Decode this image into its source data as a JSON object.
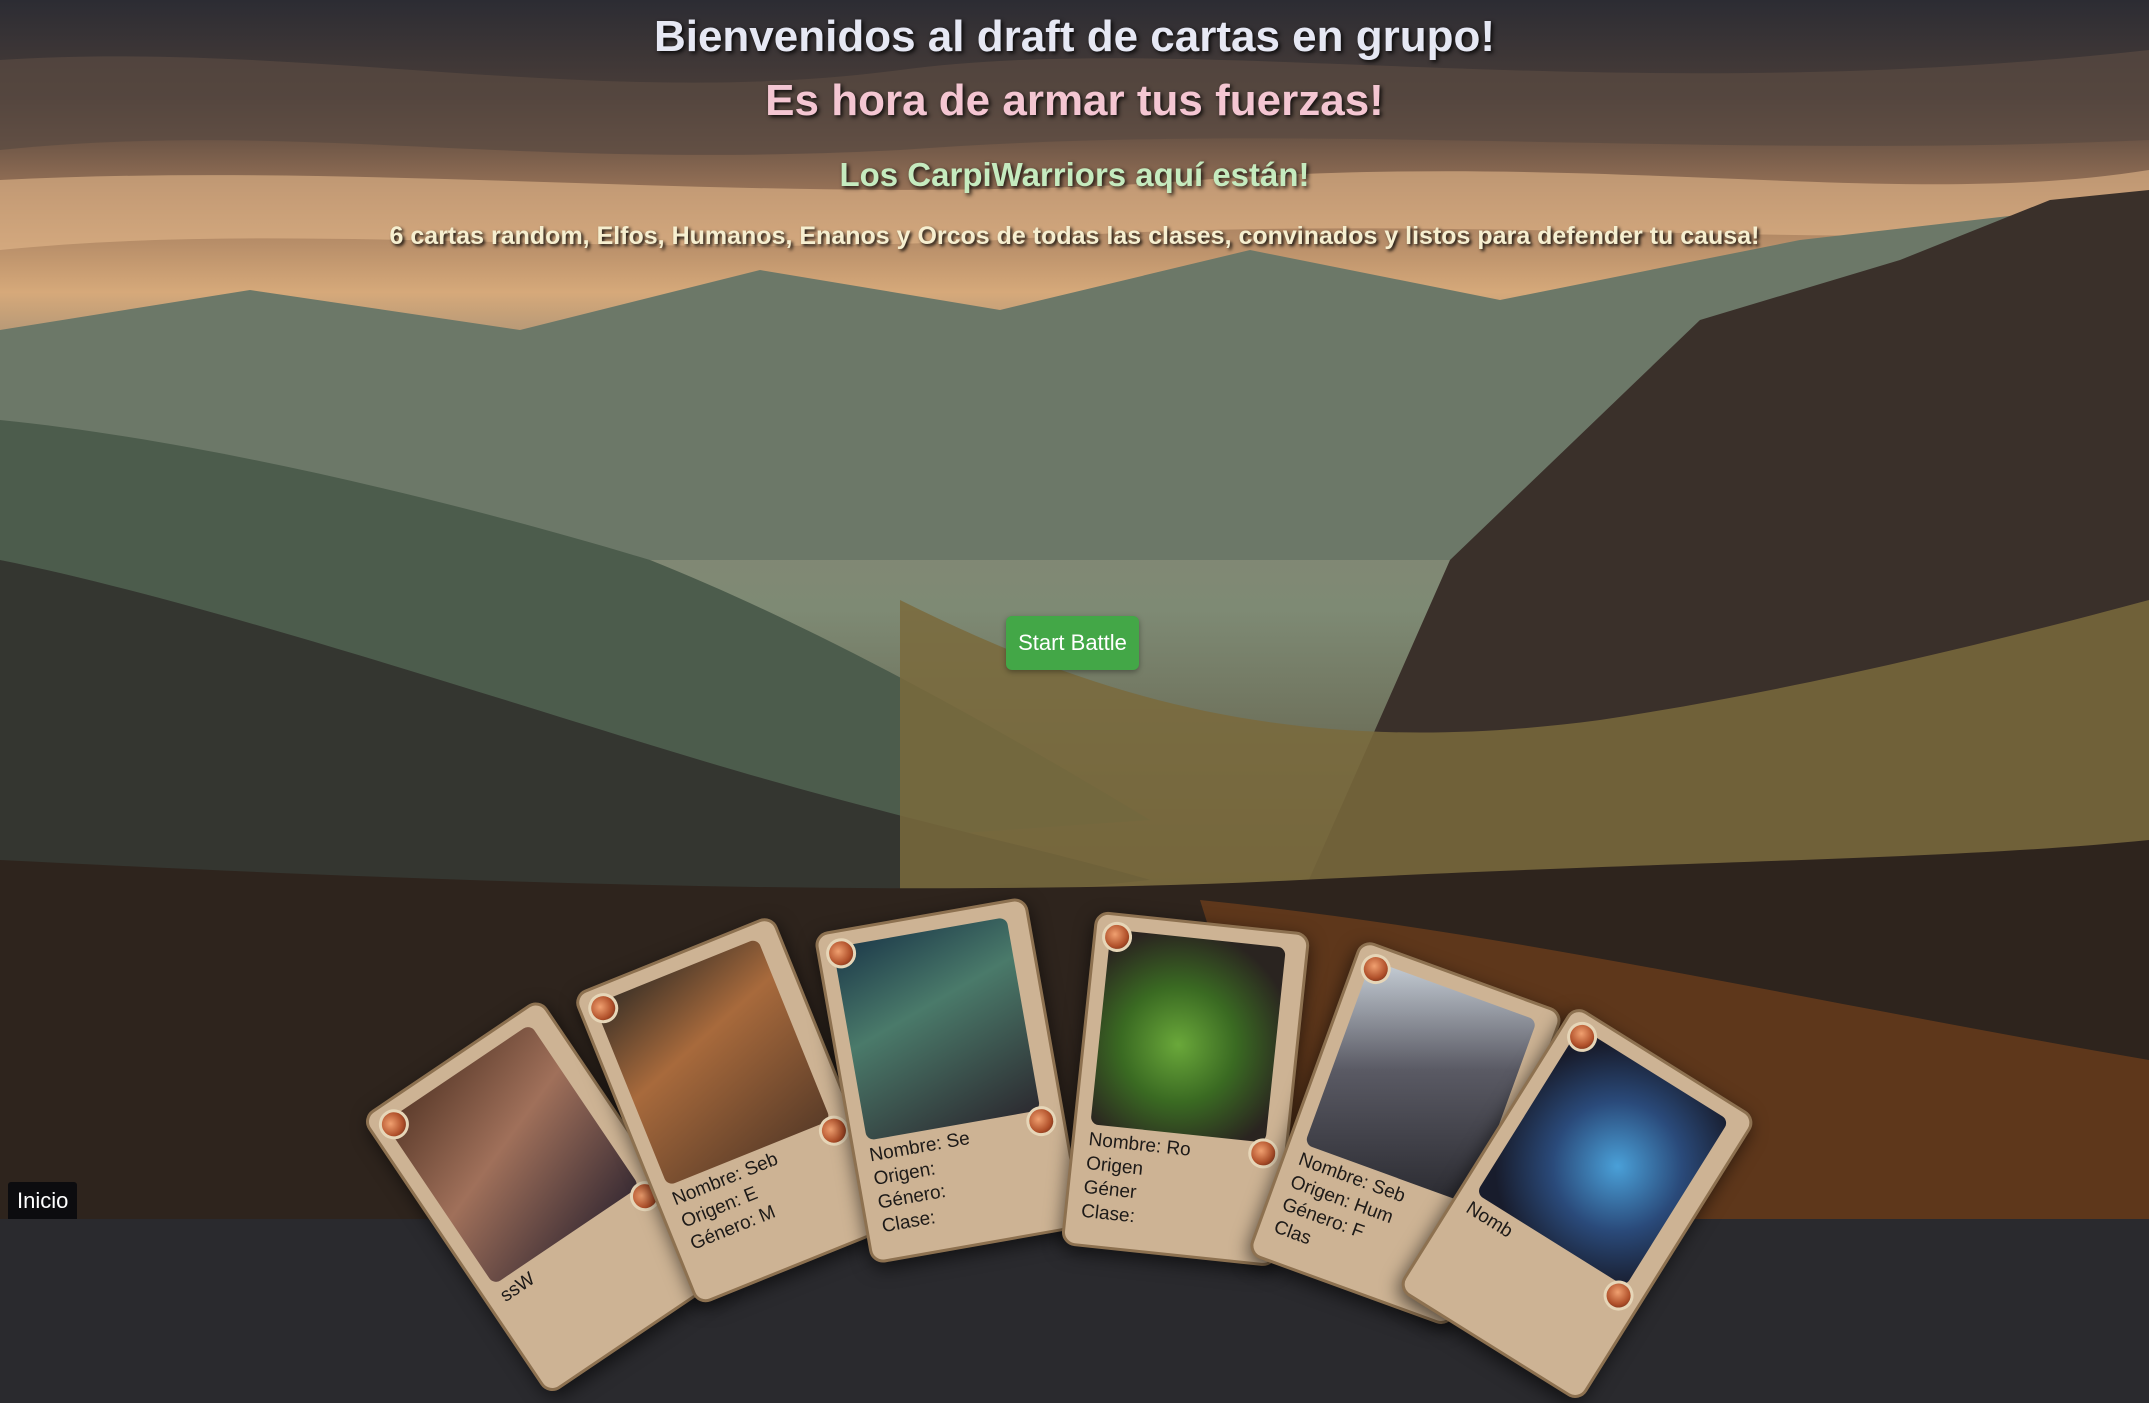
{
  "header": {
    "title": "Bienvenidos al draft de cartas en grupo!",
    "subtitle": "Es hora de armar tus fuerzas!",
    "tagline": "Los CarpiWarriors aquí están!",
    "description": "6 cartas random, Elfos, Humanos, Enanos y Orcos de todas las clases, convinados y listos para defender tu causa!"
  },
  "actions": {
    "start_label": "Start Battle"
  },
  "footer": {
    "inicio_label": "Inicio"
  },
  "colors": {
    "title": "#e6e8f4",
    "subtitle": "#f4c6d2",
    "tagline": "#c5ebbf",
    "description": "#f6efd0",
    "button": "#43a747",
    "card_frame": "#cdb394"
  },
  "cards": [
    {
      "line1": "ssW",
      "line2": "",
      "line3": ""
    },
    {
      "line1": "Nombre: Seb",
      "line2": "Origen: E",
      "line3": "Género: M"
    },
    {
      "line1": "Nombre: Se",
      "line2": "Origen:",
      "line3": "Género:",
      "line4": "Clase:"
    },
    {
      "line1": "Nombre: Ro",
      "line2": "Origen",
      "line3": "Géner",
      "line4": "Clase:"
    },
    {
      "line1": "Nombre: Seb",
      "line2": "Origen: Hum",
      "line3": "Género: F",
      "line4": "Clas"
    },
    {
      "line1": "Nomb",
      "line2": "",
      "line3": ""
    }
  ]
}
